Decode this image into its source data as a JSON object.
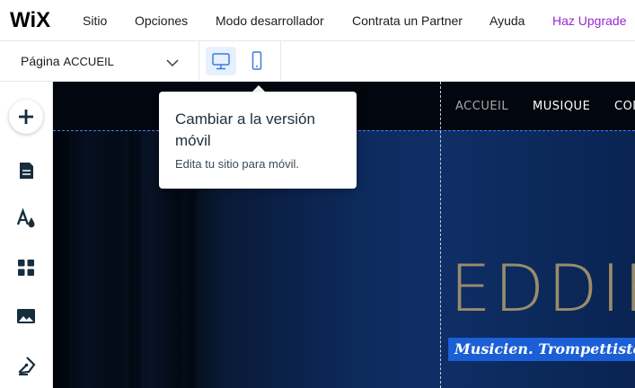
{
  "topbar": {
    "logo": "WiX",
    "menu": [
      "Sitio",
      "Opciones",
      "Modo desarrollador",
      "Contrata un Partner",
      "Ayuda"
    ],
    "upgrade": "Haz Upgrade",
    "upgrade_color": "#9a27d5"
  },
  "subbar": {
    "page_prefix": "Página",
    "page_name": "ACCUEIL",
    "dropdown_icon": "chevron-down-icon",
    "devices": [
      {
        "name": "desktop",
        "icon": "desktop-icon",
        "active": true
      },
      {
        "name": "mobile",
        "icon": "mobile-icon",
        "active": false
      }
    ]
  },
  "left_toolbar": {
    "icons": [
      "add-icon",
      "pages-icon",
      "theme-icon",
      "apps-icon",
      "media-icon",
      "blog-icon"
    ]
  },
  "tooltip": {
    "title": "Cambiar a la versión móvil",
    "body": "Edita tu sitio para móvil."
  },
  "site": {
    "nav": [
      "ACCUEIL",
      "MUSIQUE",
      "CON"
    ],
    "active_nav": "ACCUEIL",
    "title": "EDDIE",
    "subtitle": "Musicien. Trompettiste. Co",
    "accent": "#1a5fd6",
    "title_color": "#9a8c6b"
  }
}
